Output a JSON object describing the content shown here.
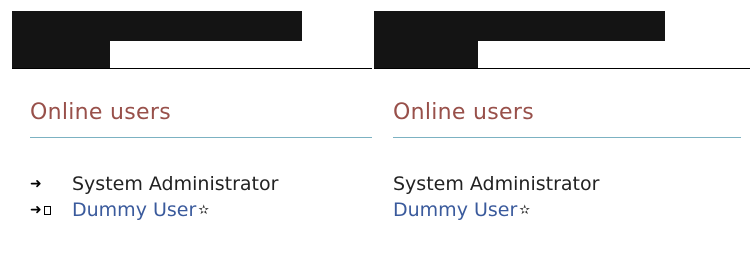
{
  "panels": [
    {
      "title": "Online users",
      "users": [
        {
          "name": "System Administrator",
          "icons": [
            "arrow-icon"
          ]
        },
        {
          "name": "Dummy User",
          "icons": [
            "arrow-icon",
            "page-icon",
            "star-icon"
          ]
        }
      ]
    },
    {
      "title": "Online users",
      "users": [
        {
          "name": "System Administrator",
          "icons": []
        },
        {
          "name": "Dummy User",
          "icons": [
            "star-icon"
          ]
        }
      ]
    }
  ],
  "glyphs": {
    "arrow": "➜",
    "star": "✫"
  },
  "colors": {
    "title": "#98504a",
    "title_rule": "#7cb2c2",
    "link_user": "#3a5a9c",
    "redaction": "#141414"
  }
}
